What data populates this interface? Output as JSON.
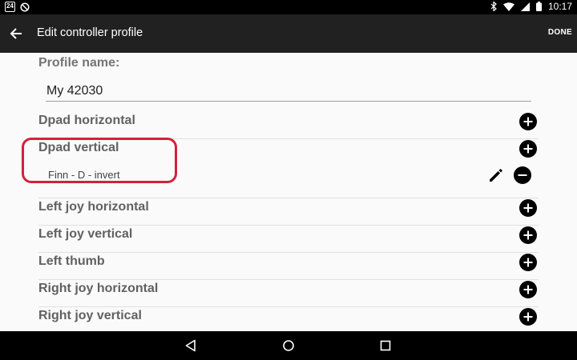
{
  "status_bar": {
    "notification_badge": "24",
    "time": "10:17"
  },
  "app_bar": {
    "title": "Edit controller profile",
    "done_label": "DONE"
  },
  "profile": {
    "label": "Profile name:",
    "value": "My 42030"
  },
  "rows": [
    {
      "label": "Dpad horizontal"
    },
    {
      "label": "Dpad vertical",
      "mapping": "Finn - D - invert"
    },
    {
      "label": "Left joy horizontal"
    },
    {
      "label": "Left joy vertical"
    },
    {
      "label": "Left thumb"
    },
    {
      "label": "Right joy horizontal"
    },
    {
      "label": "Right joy vertical"
    }
  ],
  "colors": {
    "app_bar": "#212121",
    "highlight": "#d3213a"
  },
  "icons": [
    "back-arrow-icon",
    "add-icon",
    "remove-icon",
    "pencil-icon",
    "bluetooth-icon",
    "wifi-icon",
    "signal-icon",
    "battery-icon",
    "nav-back-icon",
    "nav-home-icon",
    "nav-recents-icon"
  ]
}
